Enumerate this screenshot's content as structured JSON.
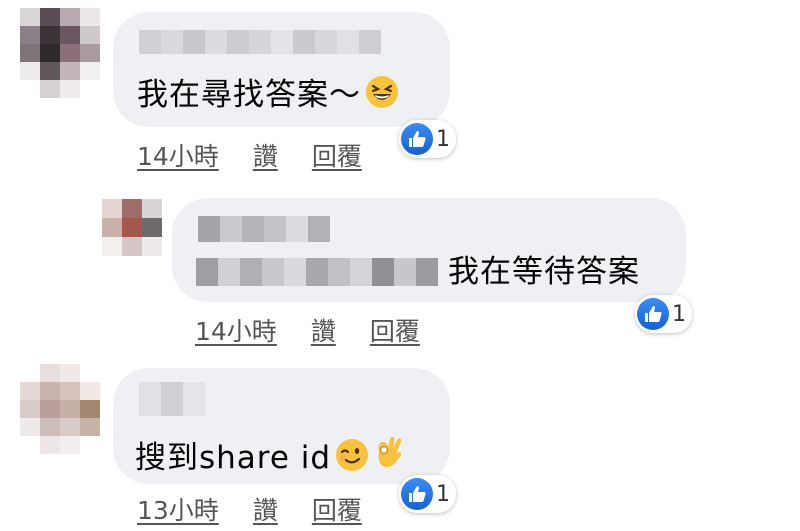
{
  "comments": [
    {
      "text": "我在尋找答案～",
      "emoji": "laughing-face",
      "time": "14小時",
      "like_label": "讚",
      "reply_label": "回覆",
      "reaction_count": "1"
    },
    {
      "text": "我在等待答案",
      "time": "14小時",
      "like_label": "讚",
      "reply_label": "回覆",
      "reaction_count": "1"
    },
    {
      "text": "搜到share id",
      "emoji": "winking-face ok-hand",
      "time": "13小時",
      "like_label": "讚",
      "reply_label": "回覆",
      "reaction_count": "1"
    }
  ],
  "colors": {
    "bubble": "#eef0f3",
    "like_blue": "#1877f2",
    "action_text": "#555555"
  }
}
